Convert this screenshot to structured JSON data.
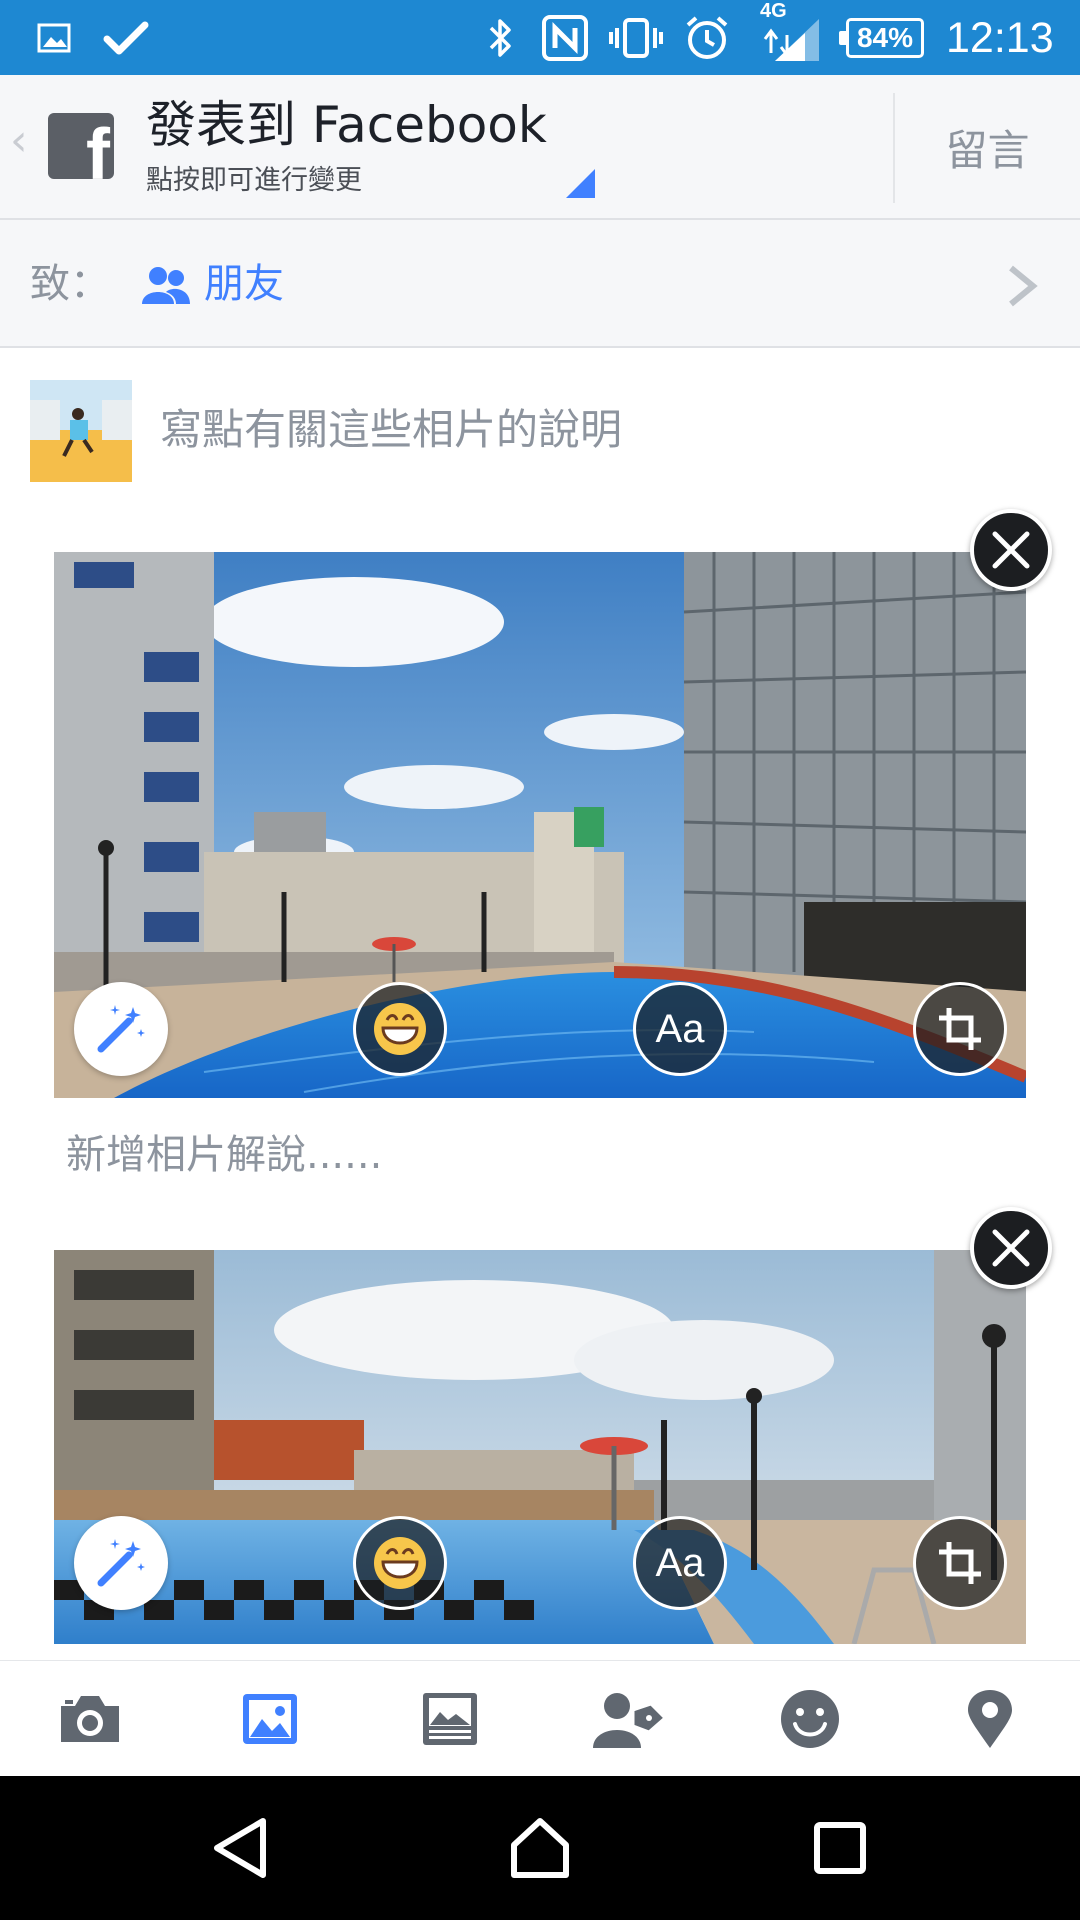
{
  "status_bar": {
    "network_label": "4G",
    "battery": "84%",
    "time": "12:13",
    "icons": [
      "gallery-notification-icon",
      "check-icon",
      "bluetooth-icon",
      "nfc-icon",
      "vibrate-icon",
      "alarm-icon",
      "signal-icon"
    ]
  },
  "header": {
    "title": "發表到 Facebook",
    "subtitle": "點按即可進行變更",
    "post_label": "留言"
  },
  "audience": {
    "to_label": "致：",
    "value": "朋友"
  },
  "composer": {
    "placeholder": "寫點有關這些相片的說明"
  },
  "photos": [
    {
      "caption_placeholder": "新增相片解說......",
      "text_tool_label": "Aa"
    },
    {
      "text_tool_label": "Aa"
    }
  ],
  "toolbar": {
    "items": [
      "camera-icon",
      "photo-icon",
      "album-icon",
      "tag-people-icon",
      "feeling-icon",
      "location-icon"
    ],
    "active_index": 1
  },
  "colors": {
    "status_bar": "#1e88d2",
    "accent": "#4080ff",
    "header_bg": "#f6f7f9",
    "muted_text": "#8d949e"
  }
}
